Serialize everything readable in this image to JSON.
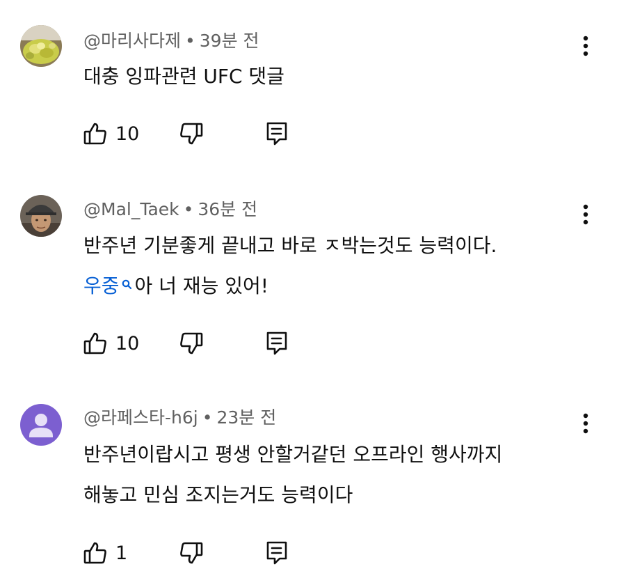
{
  "comments": [
    {
      "author": "@마리사다제",
      "separator": "•",
      "time": "39분 전",
      "lines": [
        "대충 잉파관련 UFC 댓글"
      ],
      "likes": "10",
      "avatar": "food-photo"
    },
    {
      "author": "@Mal_Taek",
      "separator": "•",
      "time": "36분 전",
      "lines": [
        "반주년 기분좋게 끝내고 바로 ㅈ박는것도 능력이다."
      ],
      "mention": "우중",
      "mention_suffix": "아 너 재능 있어!",
      "likes": "10",
      "avatar": "person-photo"
    },
    {
      "author": "@라페스타-h6j",
      "separator": "•",
      "time": "23분 전",
      "lines": [
        "반주년이랍시고 평생 안할거같던 오프라인 행사까지",
        "해놓고 민심 조지는거도 능력이다"
      ],
      "likes": "1",
      "avatar": "default-avatar"
    }
  ],
  "icons": {
    "like": "thumbs-up-icon",
    "dislike": "thumbs-down-icon",
    "reply": "reply-icon",
    "more": "more-vert-icon",
    "mention": "search-icon"
  },
  "colors": {
    "mention": "#065fd4",
    "meta": "#606060",
    "text": "#0f0f0f",
    "default_avatar_bg": "#7c5fd0"
  }
}
